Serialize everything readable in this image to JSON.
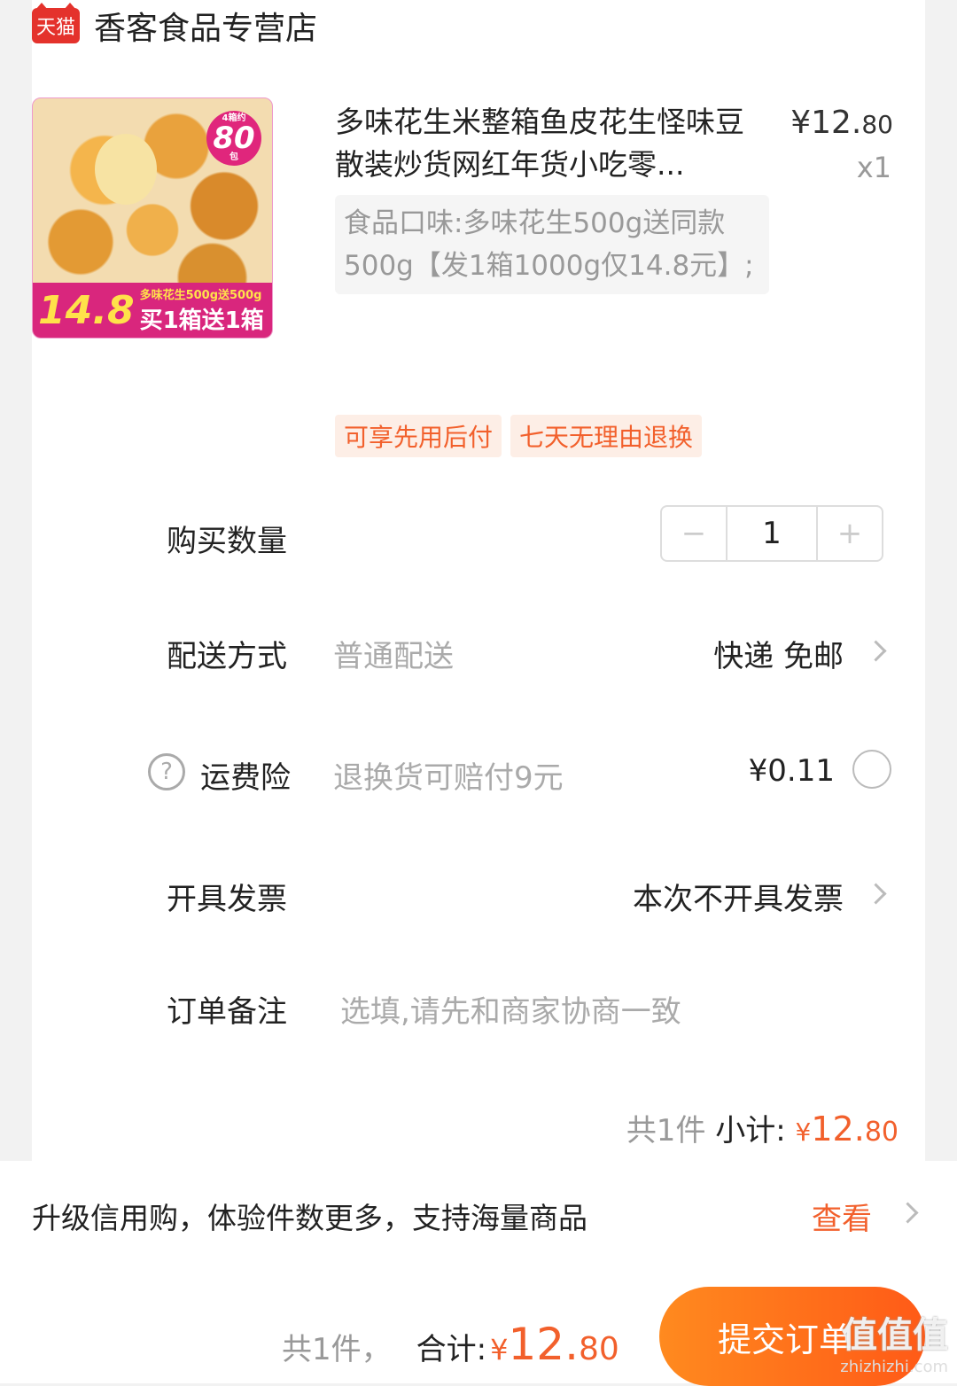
{
  "shop": {
    "badge": "天猫",
    "name": "香客食品专营店"
  },
  "product": {
    "thumbnail": {
      "weight_small": "4箱约",
      "weight_big": "80",
      "weight_unit": "包",
      "price": "14.8",
      "line1": "多味花生500g送500g",
      "line2": "买1箱送1箱"
    },
    "title": "多味花生米整箱鱼皮花生怪味豆散装炒货网红年货小吃零...",
    "price_yen": "¥",
    "price_int": "12.",
    "price_dec": "80",
    "quantity_label": "x1",
    "spec": "食品口味:多味花生500g送同款500g【发1箱1000g仅14.8元】;",
    "tags": [
      "可享先用后付",
      "七天无理由退换"
    ]
  },
  "rows": {
    "quantity": {
      "label": "购买数量",
      "value": "1",
      "minus": "−",
      "plus": "+"
    },
    "delivery": {
      "label": "配送方式",
      "sub": "普通配送",
      "value": "快递 免邮"
    },
    "insurance": {
      "label": "运费险",
      "sub": "退换货可赔付9元",
      "value": "¥0.11",
      "icon": "?"
    },
    "invoice": {
      "label": "开具发票",
      "value": "本次不开具发票"
    },
    "note": {
      "label": "订单备注",
      "placeholder": "选填,请先和商家协商一致"
    }
  },
  "subtotal": {
    "count": "共1件",
    "label": "小计:",
    "yen": "¥",
    "int": "12.",
    "dec": "80"
  },
  "promo": {
    "text": "升级信用购，体验件数更多，支持海量商品",
    "link": "查看"
  },
  "footer": {
    "count": "共1件，",
    "label": "合计:",
    "yen": "¥",
    "int": "12.",
    "dec": "80",
    "submit": "提交订单"
  },
  "watermark": {
    "big": "值值值",
    "small": "zhizhizhi.com"
  },
  "colors": {
    "accent": "#f2602c",
    "submit_start": "#ff8a1f",
    "submit_end": "#ff5a17",
    "tmall": "#e4322c"
  }
}
